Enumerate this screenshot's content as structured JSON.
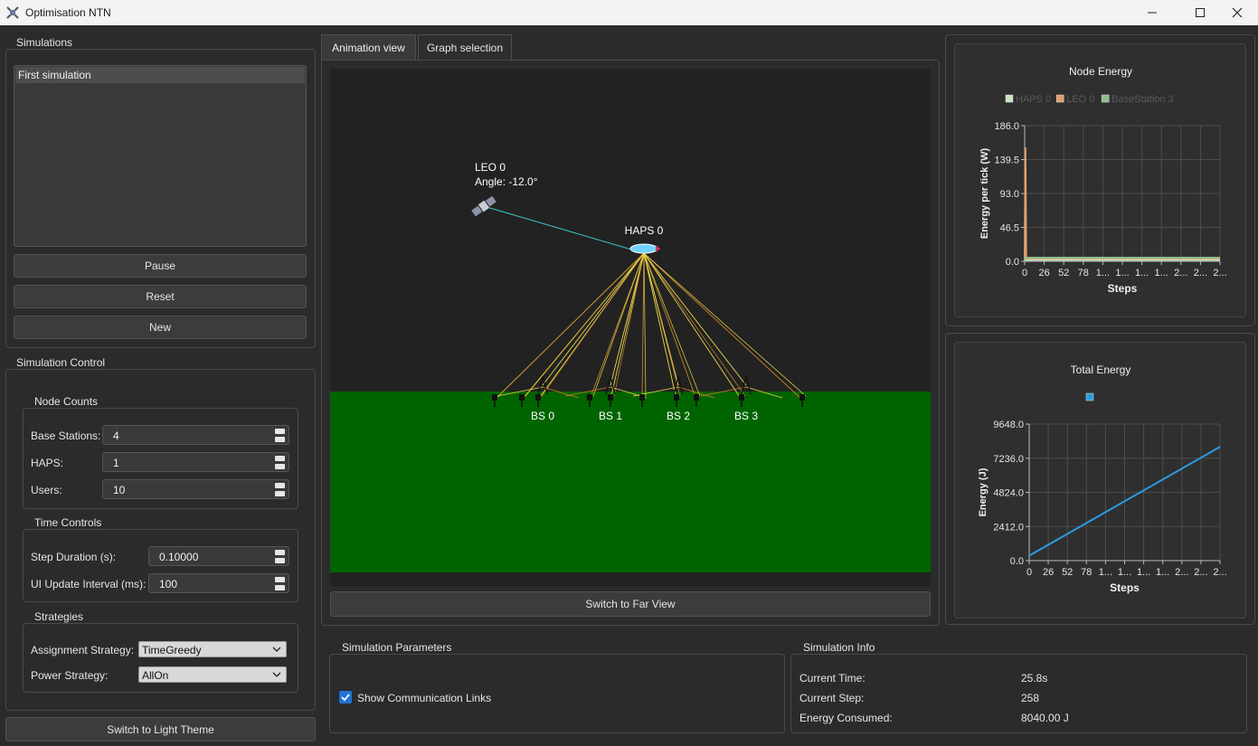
{
  "window": {
    "title": "Optimisation NTN",
    "controls": [
      "minimize-icon",
      "maximize-icon",
      "close-icon"
    ]
  },
  "simulations": {
    "label": "Simulations",
    "items": [
      "First simulation"
    ],
    "pause": "Pause",
    "reset": "Reset",
    "new": "New"
  },
  "control": {
    "label": "Simulation Control",
    "node_counts": {
      "label": "Node Counts",
      "base_stations_label": "Base Stations:",
      "base_stations": "4",
      "haps_label": "HAPS:",
      "haps": "1",
      "users_label": "Users:",
      "users": "10"
    },
    "time_controls": {
      "label": "Time Controls",
      "step_label": "Step Duration (s):",
      "step": "0.10000",
      "ui_label": "UI Update Interval (ms):",
      "ui": "100"
    },
    "strategies": {
      "label": "Strategies",
      "assignment_label": "Assignment Strategy:",
      "assignment": "TimeGreedy",
      "power_label": "Power Strategy:",
      "power": "AllOn"
    },
    "theme_button": "Switch to Light Theme"
  },
  "tabs": [
    "Animation view",
    "Graph selection"
  ],
  "animation": {
    "leo_label": "LEO 0",
    "leo_angle": "Angle: -12.0°",
    "haps_label": "HAPS 0",
    "bs_labels": [
      "BS 0",
      "BS 1",
      "BS 2",
      "BS 3"
    ],
    "sky_color": "#222222",
    "ground_color": "#006400",
    "link_colors": [
      "#e8d84a",
      "#c9822a",
      "#3cc6c6"
    ],
    "switch_view": "Switch to Far View"
  },
  "sim_params": {
    "label": "Simulation Parameters",
    "show_links_label": "Show Communication Links",
    "show_links": true
  },
  "sim_info": {
    "label": "Simulation Info",
    "time_label": "Current Time:",
    "time": "25.8s",
    "step_label": "Current Step:",
    "step": "258",
    "energy_label": "Energy Consumed:",
    "energy": "8040.00 J"
  },
  "chart_data": [
    {
      "type": "line",
      "title": "Node Energy",
      "xlabel": "Steps",
      "ylabel": "Energy per tick (W)",
      "y_ticks": [
        "0.0",
        "46.5",
        "93.0",
        "139.5",
        "186.0"
      ],
      "x_ticks": [
        "0",
        "26",
        "52",
        "78",
        "1...",
        "1...",
        "1...",
        "1...",
        "2...",
        "2...",
        "2..."
      ],
      "ylim": [
        0,
        186
      ],
      "xlim": [
        0,
        258
      ],
      "grid": true,
      "legend_position": "top",
      "series": [
        {
          "name": "HAPS 0",
          "color": "#c8e6c0",
          "x": [
            0,
            1,
            2,
            258
          ],
          "y": [
            0,
            2,
            2,
            2
          ]
        },
        {
          "name": "LEO 0",
          "color": "#e0a070",
          "x": [
            0,
            1,
            2,
            258
          ],
          "y": [
            0,
            156,
            4,
            4
          ]
        },
        {
          "name": "BaseStation 3",
          "color": "#8fbf8f",
          "x": [
            0,
            1,
            2,
            258
          ],
          "y": [
            0,
            5,
            5,
            5
          ]
        }
      ]
    },
    {
      "type": "line",
      "title": "Total Energy",
      "xlabel": "Steps",
      "ylabel": "Energy (J)",
      "y_ticks": [
        "0.0",
        "2412.0",
        "4824.0",
        "7236.0",
        "9648.0"
      ],
      "x_ticks": [
        "0",
        "26",
        "52",
        "78",
        "1...",
        "1...",
        "1...",
        "1...",
        "2...",
        "2...",
        "2..."
      ],
      "ylim": [
        0,
        9648
      ],
      "xlim": [
        0,
        258
      ],
      "grid": true,
      "legend_position": "top",
      "series": [
        {
          "color": "#2b9be0",
          "x": [
            0,
            258
          ],
          "y": [
            350,
            8040
          ]
        }
      ]
    }
  ]
}
